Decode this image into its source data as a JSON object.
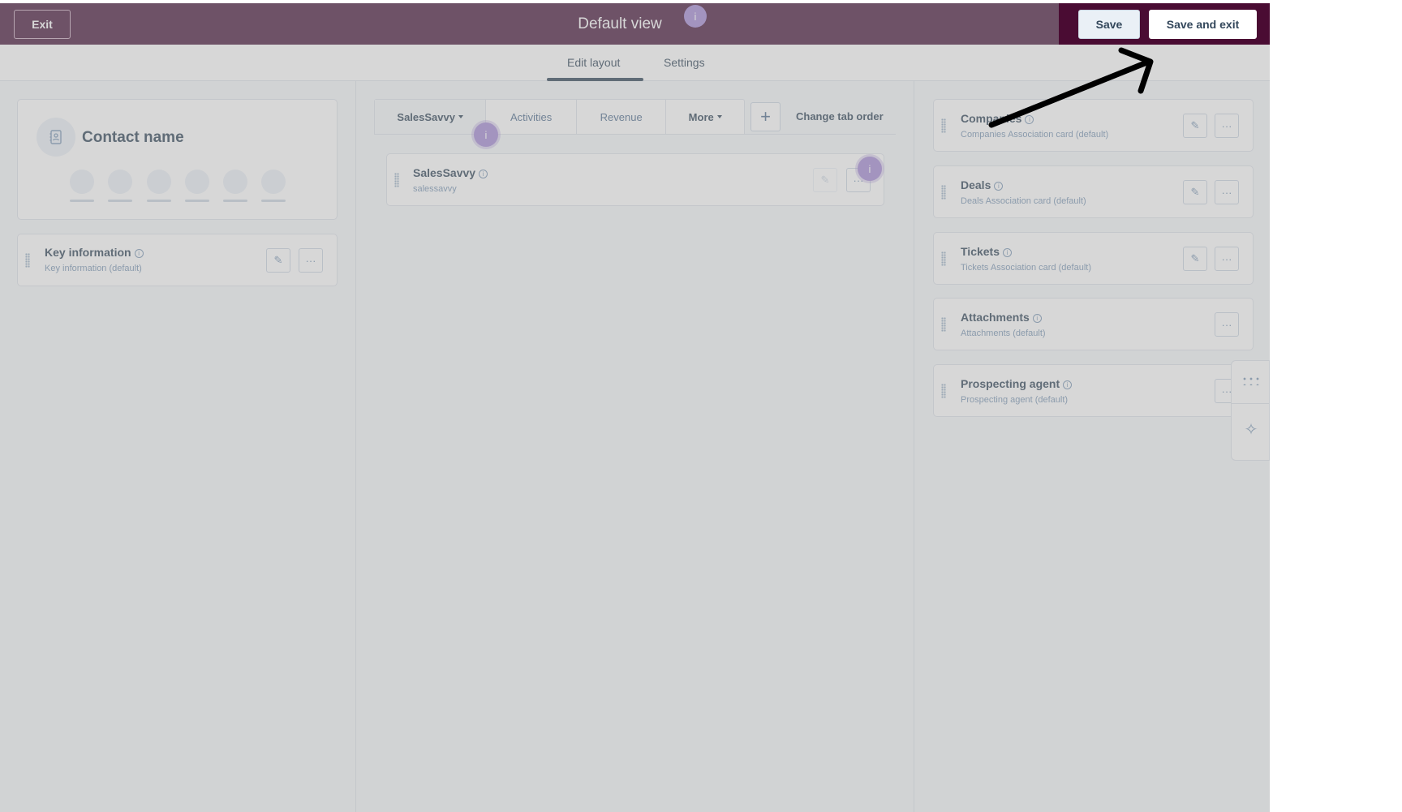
{
  "header": {
    "exit_label": "Exit",
    "title": "Default view",
    "save_label": "Save",
    "save_exit_label": "Save and exit",
    "beacon": "i"
  },
  "tabs": [
    {
      "label": "Edit layout",
      "active": true
    },
    {
      "label": "Settings",
      "active": false
    }
  ],
  "left": {
    "contact_name": "Contact name",
    "key_info": {
      "title": "Key information",
      "subtitle": "Key information (default)"
    }
  },
  "middle": {
    "tabs": [
      {
        "label": "SalesSavvy",
        "dropdown": true,
        "active": true
      },
      {
        "label": "Activities",
        "dropdown": false,
        "active": false
      },
      {
        "label": "Revenue",
        "dropdown": false,
        "active": false
      },
      {
        "label": "More",
        "dropdown": true,
        "active": false
      }
    ],
    "change_tab_order": "Change tab order",
    "card": {
      "title": "SalesSavvy",
      "subtitle": "salessavvy"
    },
    "beacon": "i"
  },
  "right": {
    "cards": [
      {
        "title": "Companies",
        "subtitle": "Companies Association card (default)",
        "editable": true
      },
      {
        "title": "Deals",
        "subtitle": "Deals Association card (default)",
        "editable": true
      },
      {
        "title": "Tickets",
        "subtitle": "Tickets Association card (default)",
        "editable": true
      },
      {
        "title": "Attachments",
        "subtitle": "Attachments (default)",
        "editable": false
      },
      {
        "title": "Prospecting agent",
        "subtitle": "Prospecting agent (default)",
        "editable": false
      }
    ]
  },
  "colors": {
    "header_bg": "#4a1a3e",
    "highlight_bg": "#4a0c33",
    "beacon": "#a68cd6",
    "text": "#33475b"
  },
  "icons": [
    "contact-card-icon",
    "info-icon",
    "drag-handle-icon",
    "pencil-icon",
    "ellipsis-icon",
    "plus-icon",
    "grid-dots-icon",
    "sparkle-icon",
    "arrow-annotation-icon"
  ]
}
